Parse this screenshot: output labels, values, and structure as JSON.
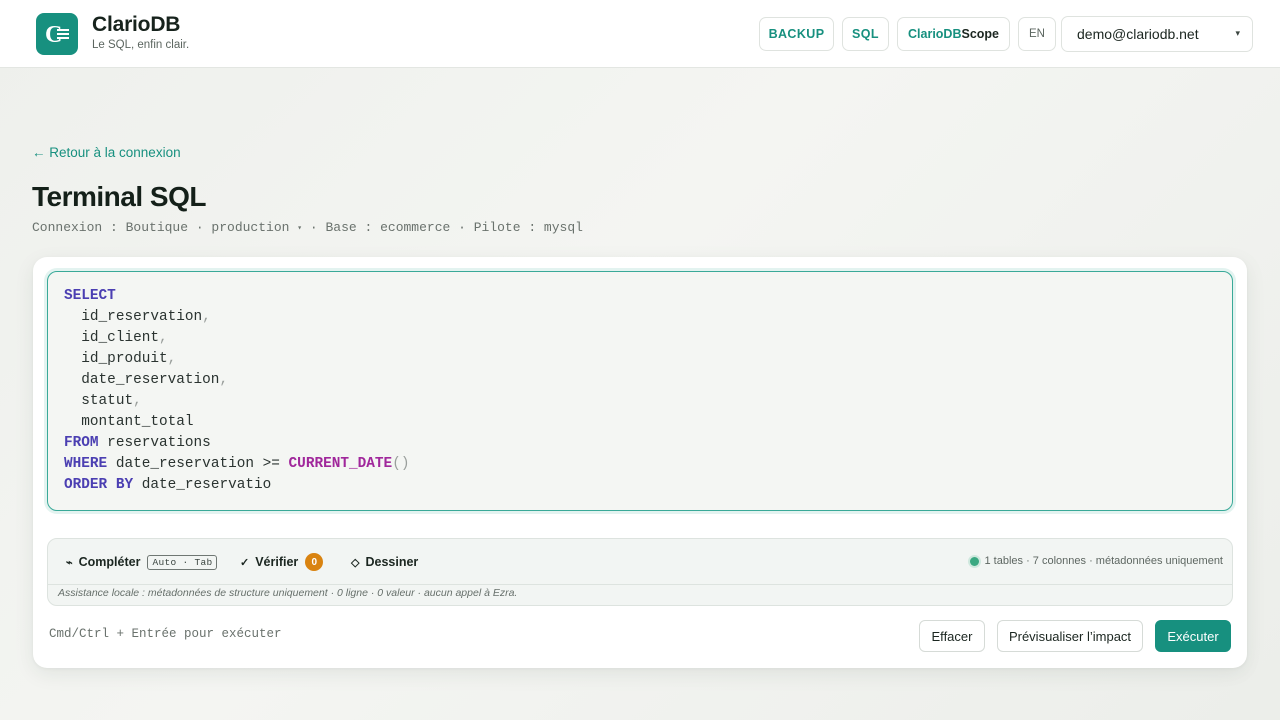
{
  "header": {
    "logo_letter": "C",
    "brand_name": "ClarioDB",
    "tagline": "Le SQL, enfin clair.",
    "buttons": {
      "backup": "BACKUP",
      "sql": "SQL",
      "scope_brand": "ClarioDB",
      "scope_suffix": "Scope",
      "lang": "EN"
    },
    "user": {
      "email": "demo@clariodb.net",
      "caret": "▾"
    }
  },
  "main": {
    "back_link": "← Retour à la connexion",
    "title": "Terminal SQL",
    "connection": {
      "prefix": "Connexion : Boutique · production",
      "env_caret": "▾",
      "suffix": " · Base : ecommerce · Pilote : mysql"
    }
  },
  "editor": {
    "lines": [
      {
        "kw": "SELECT"
      },
      {
        "text": "  id_reservation",
        "pun": ","
      },
      {
        "text": "  id_client",
        "pun": ","
      },
      {
        "text": "  id_produit",
        "pun": ","
      },
      {
        "text": "  date_reservation",
        "pun": ","
      },
      {
        "text": "  statut",
        "pun": ","
      },
      {
        "text": "  montant_total"
      },
      {
        "kw": "FROM",
        "text": " reservations"
      },
      {
        "kw": "WHERE",
        "text": " date_reservation >= ",
        "fn": "CURRENT_DATE",
        "pun": "()"
      },
      {
        "kw": "ORDER BY",
        "text": " date_reservatio"
      }
    ]
  },
  "assist": {
    "complete_label": "Compléter",
    "complete_kbd": "Auto · Tab",
    "verify_label": "Vérifier",
    "verify_count": "0",
    "draw_label": "Dessiner",
    "meta": "1 tables · 7 colonnes · métadonnées uniquement",
    "note": "Assistance locale : métadonnées de structure uniquement · 0 ligne · 0 valeur · aucun appel à Ezra."
  },
  "footer": {
    "hint": "Cmd/Ctrl + Entrée pour exécuter",
    "clear": "Effacer",
    "preview": "Prévisualiser l’impact",
    "execute": "Exécuter"
  },
  "colors": {
    "accent": "#17907f",
    "keyword": "#4b3fb2",
    "function": "#a0279b",
    "warning_badge": "#d98310",
    "status_ok": "#3aa881"
  }
}
